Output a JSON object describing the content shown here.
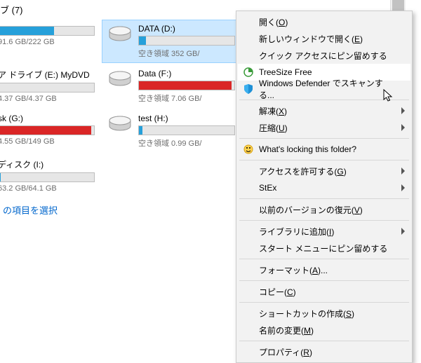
{
  "section": {
    "header": "ブ (7)"
  },
  "drives": [
    {
      "name": "DATA (D:)",
      "free": "空き領域 352 GB/",
      "fill_pct": 7,
      "color": "blue",
      "selected": true
    },
    {
      "name": "",
      "free": "91.6 GB/222 GB",
      "fill_pct": 58,
      "color": "blue"
    },
    {
      "name": "ア ドライブ (E:) MyDVD",
      "free": "4.37 GB/4.37 GB",
      "fill_pct": 0,
      "color": "blue"
    },
    {
      "name": "Data (F:)",
      "free": "空き領域 7.06 GB/",
      "fill_pct": 97,
      "color": "red"
    },
    {
      "name": "sk (G:)",
      "free": "4.55 GB/149 GB",
      "fill_pct": 97,
      "color": "red"
    },
    {
      "name": "test (H:)",
      "free": "空き領域 0.99 GB/",
      "fill_pct": 4,
      "color": "blue"
    },
    {
      "name": "ディスク (I:)",
      "free": "63.2 GB/64.1 GB",
      "fill_pct": 2,
      "color": "blue"
    }
  ],
  "footer": {
    "link": "の項目を選択"
  },
  "menu": [
    {
      "type": "item",
      "label": "開く(",
      "hot": "O",
      "label2": ")"
    },
    {
      "type": "item",
      "label": "新しいウィンドウで開く(",
      "hot": "E",
      "label2": ")"
    },
    {
      "type": "item",
      "label": "クイック アクセスにピン留めする"
    },
    {
      "type": "item",
      "label": "TreeSize Free",
      "icon": "treesize",
      "hover": true
    },
    {
      "type": "item",
      "label": "Windows Defender でスキャンする...",
      "icon": "defender"
    },
    {
      "type": "sep"
    },
    {
      "type": "item",
      "label": "解凍(",
      "hot": "X",
      "label2": ")",
      "submenu": true
    },
    {
      "type": "item",
      "label": "圧縮(",
      "hot": "U",
      "label2": ")",
      "submenu": true
    },
    {
      "type": "sep"
    },
    {
      "type": "item",
      "label": "What's locking this folder?",
      "icon": "locking"
    },
    {
      "type": "sep"
    },
    {
      "type": "item",
      "label": "アクセスを許可する(",
      "hot": "G",
      "label2": ")",
      "submenu": true
    },
    {
      "type": "item",
      "label": "StEx",
      "submenu": true
    },
    {
      "type": "sep"
    },
    {
      "type": "item",
      "label": "以前のバージョンの復元(",
      "hot": "V",
      "label2": ")"
    },
    {
      "type": "sep"
    },
    {
      "type": "item",
      "label": "ライブラリに追加(",
      "hot": "I",
      "label2": ")",
      "submenu": true
    },
    {
      "type": "item",
      "label": "スタート メニューにピン留めする"
    },
    {
      "type": "sep"
    },
    {
      "type": "item",
      "label": "フォーマット(",
      "hot": "A",
      "label2": ")..."
    },
    {
      "type": "sep"
    },
    {
      "type": "item",
      "label": "コピー(",
      "hot": "C",
      "label2": ")"
    },
    {
      "type": "sep"
    },
    {
      "type": "item",
      "label": "ショートカットの作成(",
      "hot": "S",
      "label2": ")"
    },
    {
      "type": "item",
      "label": "名前の変更(",
      "hot": "M",
      "label2": ")"
    },
    {
      "type": "sep"
    },
    {
      "type": "item",
      "label": "プロパティ(",
      "hot": "R",
      "label2": ")"
    }
  ]
}
